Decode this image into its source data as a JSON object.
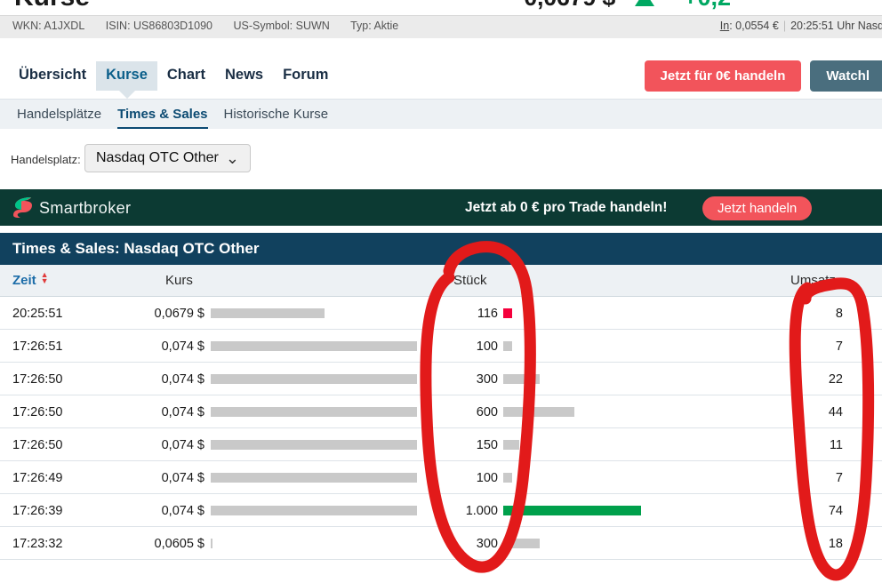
{
  "header": {
    "instrument_title": "Kurse",
    "last_price": "0,0679 $",
    "change_pct": "+0,2",
    "change_direction": "up",
    "meta": [
      "WKN: A1JXDL",
      "ISIN: US86803D1090",
      "US-Symbol: SUWN",
      "Typ: Aktie"
    ],
    "quote_label": "In",
    "quote_value": "0,0554 €",
    "quote_time": "20:25:51 Uhr Nasd"
  },
  "nav": {
    "tabs": [
      {
        "label": "Übersicht",
        "active": false
      },
      {
        "label": "Kurse",
        "active": true
      },
      {
        "label": "Chart",
        "active": false
      },
      {
        "label": "News",
        "active": false
      },
      {
        "label": "Forum",
        "active": false
      }
    ],
    "buttons": {
      "trade": "Jetzt für 0€ handeln",
      "watchlist": "Watchl"
    }
  },
  "subnav": {
    "tabs": [
      {
        "label": "Handelsplätze",
        "active": false
      },
      {
        "label": "Times & Sales",
        "active": true
      },
      {
        "label": "Historische Kurse",
        "active": false
      }
    ]
  },
  "venue": {
    "label": "Handelsplatz:",
    "selected": "Nasdaq OTC Other",
    "caret": "chevron-down-icon"
  },
  "banner": {
    "brand": "Smartbroker",
    "message": "Jetzt ab 0 € pro Trade handeln!",
    "cta": "Jetzt handeln",
    "bg_color": "#0c3a33",
    "cta_color": "#f2545b"
  },
  "table": {
    "title": "Times & Sales: Nasdaq OTC Other",
    "columns": [
      {
        "key": "zeit",
        "label": "Zeit",
        "sortable": true
      },
      {
        "key": "kurs",
        "label": "Kurs",
        "sortable": false
      },
      {
        "key": "stueck",
        "label": "Stück",
        "sortable": false
      },
      {
        "key": "umsatz",
        "label": "Umsatz",
        "sortable": false
      }
    ],
    "rows": [
      {
        "zeit": "20:25:51",
        "kurs": "0,0679 $",
        "stueck": "116",
        "umsatz": "8",
        "price_bar_pct": 55,
        "qty_bar_pct": 4,
        "qty_bar_color": "#f5003c"
      },
      {
        "zeit": "17:26:51",
        "kurs": "0,074 $",
        "stueck": "100",
        "umsatz": "7",
        "price_bar_pct": 100,
        "qty_bar_pct": 4,
        "qty_bar_color": "#c9c9c9"
      },
      {
        "zeit": "17:26:50",
        "kurs": "0,074 $",
        "stueck": "300",
        "umsatz": "22",
        "price_bar_pct": 100,
        "qty_bar_pct": 16,
        "qty_bar_color": "#c9c9c9"
      },
      {
        "zeit": "17:26:50",
        "kurs": "0,074 $",
        "stueck": "600",
        "umsatz": "44",
        "price_bar_pct": 100,
        "qty_bar_pct": 31,
        "qty_bar_color": "#c9c9c9"
      },
      {
        "zeit": "17:26:50",
        "kurs": "0,074 $",
        "stueck": "150",
        "umsatz": "11",
        "price_bar_pct": 100,
        "qty_bar_pct": 7,
        "qty_bar_color": "#c9c9c9"
      },
      {
        "zeit": "17:26:49",
        "kurs": "0,074 $",
        "stueck": "100",
        "umsatz": "7",
        "price_bar_pct": 100,
        "qty_bar_pct": 4,
        "qty_bar_color": "#c9c9c9"
      },
      {
        "zeit": "17:26:39",
        "kurs": "0,074 $",
        "stueck": "1.000",
        "umsatz": "74",
        "price_bar_pct": 100,
        "qty_bar_pct": 60,
        "qty_bar_color": "#00a04b"
      },
      {
        "zeit": "17:23:32",
        "kurs": "0,0605 $",
        "stueck": "300",
        "umsatz": "18",
        "price_bar_pct": 1,
        "qty_bar_pct": 16,
        "qty_bar_color": "#c9c9c9"
      }
    ]
  },
  "annotations": {
    "color": "#e21a1a",
    "shapes": [
      {
        "name": "stueck-column-circle",
        "type": "ellipse"
      },
      {
        "name": "umsatz-column-circle",
        "type": "ellipse"
      }
    ]
  }
}
